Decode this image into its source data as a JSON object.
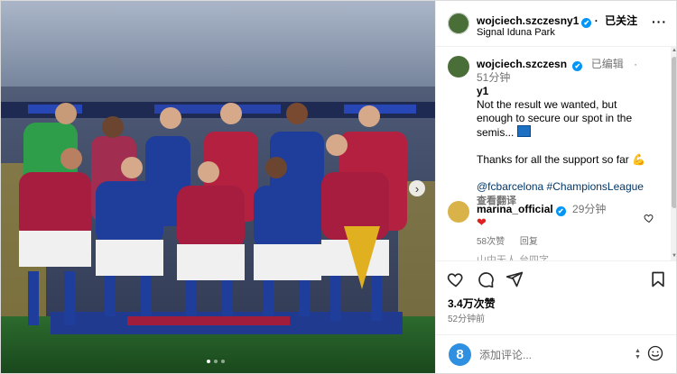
{
  "post": {
    "username": "wojciech.szczesny1",
    "verified_badge": "✔",
    "follow_status": "已关注",
    "location": "Signal Iduna Park",
    "more": "···"
  },
  "caption": {
    "username_part1": "wojciech.szczesn",
    "username_part2": "y1",
    "edited": "已编辑",
    "time": "· 51分钟",
    "line1": "Not the result we wanted, but enough to secure our spot in the semis...",
    "line2": "Thanks for all the support so far",
    "tags": "@fcbarcelona #ChampionsLeague",
    "translate": "查看翻译"
  },
  "comment": {
    "username": "marina_official",
    "time": "29分钟",
    "likes": "58次赞",
    "reply": "回复",
    "next_partial": "山中无人 台四字"
  },
  "stats": {
    "likes": "3.4万次赞",
    "time": "52分钟前"
  },
  "add_comment": {
    "icon_label": "8",
    "placeholder": "添加评论..."
  },
  "photo": {
    "next_icon": "›",
    "dots": 3,
    "active_dot": 1
  },
  "icons": {
    "like": "heart-icon",
    "comment": "comment-icon",
    "share": "share-icon",
    "save": "bookmark-icon",
    "emoji": "smile-icon"
  },
  "colors": {
    "accent": "#0095f6",
    "link": "#00376b",
    "muted": "#737373",
    "heart": "#e02020"
  }
}
